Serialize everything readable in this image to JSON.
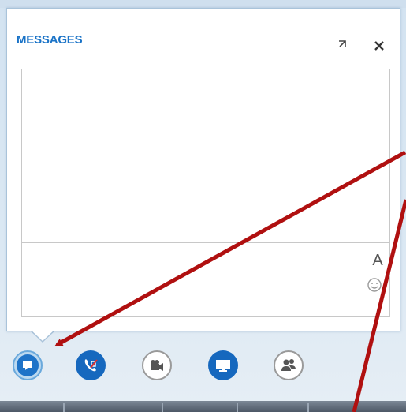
{
  "panel": {
    "title": "MESSAGES",
    "popout_icon": "popout-icon",
    "close_icon": "close-icon",
    "font_label": "A",
    "emoji_icon": "emoji-icon"
  },
  "toolbar": {
    "buttons": [
      {
        "name": "im-button",
        "icon": "chat-bubble-icon",
        "active": true
      },
      {
        "name": "call-button",
        "icon": "phone-muted-icon"
      },
      {
        "name": "video-button",
        "icon": "video-camera-icon"
      },
      {
        "name": "present-button",
        "icon": "monitor-icon"
      },
      {
        "name": "participants-button",
        "icon": "people-icon"
      }
    ]
  },
  "colors": {
    "accent": "#1a73c7",
    "button_blue": "#1668be",
    "annotation_red": "#b01010"
  }
}
